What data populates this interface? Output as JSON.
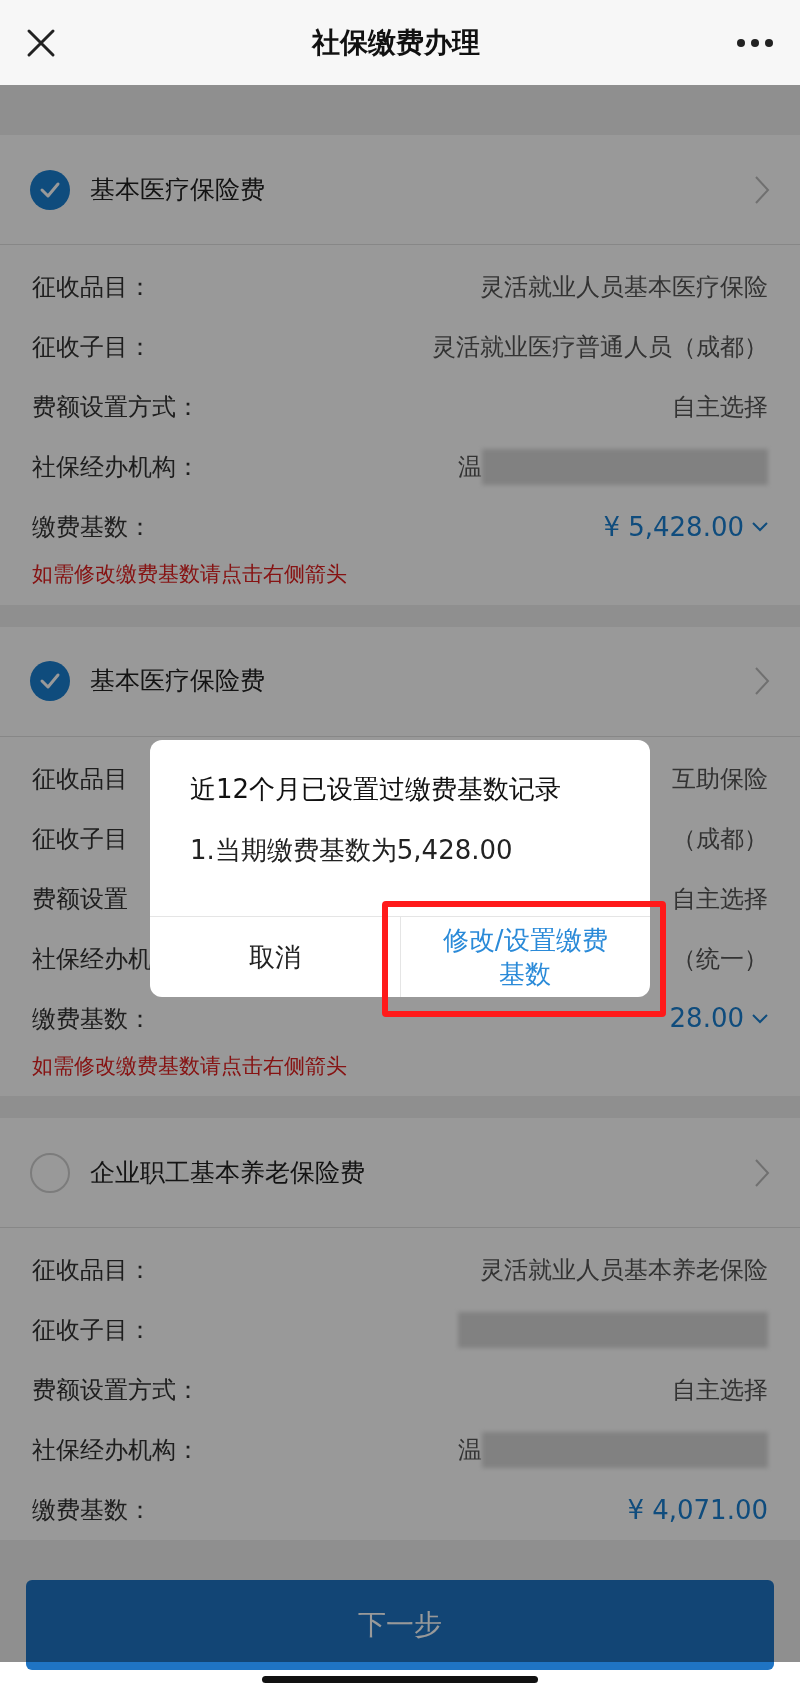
{
  "header": {
    "title": "社保缴费办理"
  },
  "items": [
    {
      "title": "基本医疗保险费",
      "checked": true,
      "rows": [
        {
          "label": "征收品目：",
          "value": "灵活就业人员基本医疗保险",
          "kind": "text"
        },
        {
          "label": "征收子目：",
          "value": "灵活就业医疗普通人员（成都）",
          "kind": "text"
        },
        {
          "label": "费额设置方式：",
          "value": "自主选择",
          "kind": "text"
        },
        {
          "label": "社保经办机构：",
          "value": "温",
          "kind": "redacted"
        },
        {
          "label": "缴费基数：",
          "value": "¥ 5,428.00",
          "kind": "dropdown"
        }
      ],
      "note": "如需修改缴费基数请点击右侧箭头"
    },
    {
      "title": "基本医疗保险费",
      "checked": true,
      "rows": [
        {
          "label": "征收品目",
          "value": "互助保险",
          "kind": "text"
        },
        {
          "label": "征收子目",
          "value": "（成都）",
          "kind": "text"
        },
        {
          "label": "费额设置",
          "value": "自主选择",
          "kind": "text"
        },
        {
          "label": "社保经办机",
          "value": "（统一）",
          "kind": "text"
        },
        {
          "label": "缴费基数：",
          "value": "28.00",
          "kind": "dropdown"
        }
      ],
      "note": "如需修改缴费基数请点击右侧箭头"
    },
    {
      "title": "企业职工基本养老保险费",
      "checked": false,
      "rows": [
        {
          "label": "征收品目：",
          "value": "灵活就业人员基本养老保险",
          "kind": "text"
        },
        {
          "label": "征收子目：",
          "kind": "redacted"
        },
        {
          "label": "费额设置方式：",
          "value": "自主选择",
          "kind": "text"
        },
        {
          "label": "社保经办机构：",
          "value": "温",
          "kind": "redacted"
        },
        {
          "label": "缴费基数：",
          "value": "¥ 4,071.00",
          "kind": "amount"
        }
      ]
    }
  ],
  "next_button": "下一步",
  "dialog": {
    "title": "近12个月已设置过缴费基数记录",
    "message": "1.当期缴费基数为5,428.00",
    "buttons": [
      {
        "label": "取消",
        "highlighted": false
      },
      {
        "label": "修改/设置缴费基数",
        "highlighted": true
      }
    ]
  }
}
